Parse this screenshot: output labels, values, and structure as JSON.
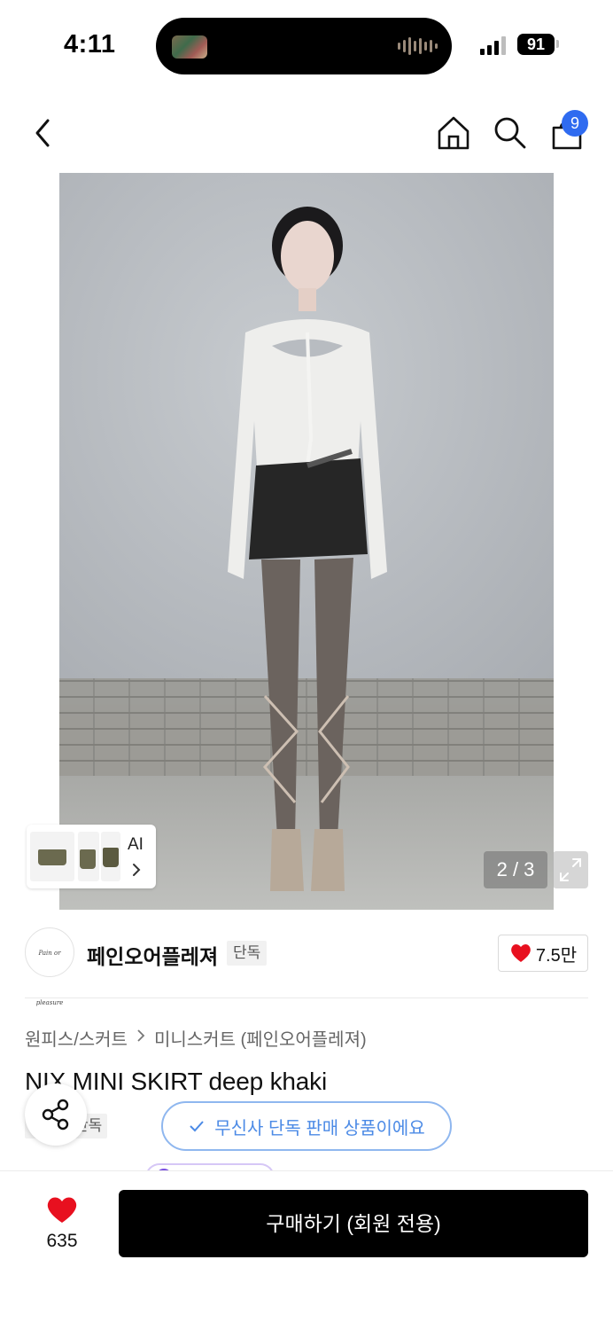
{
  "status_bar": {
    "time": "4:11",
    "battery": "91"
  },
  "nav": {
    "cart_count": "9"
  },
  "gallery": {
    "counter": "2 / 3",
    "ai_label": "AI"
  },
  "brand": {
    "name": "페인오어플레져",
    "tag": "단독",
    "logo_text": "Pain or pleasure",
    "likes": "7.5만"
  },
  "breadcrumb": [
    "원피스/스커트",
    "미니스커트 (페인오어플레져)"
  ],
  "product": {
    "title": "NIX MINI SKIRT deep khaki",
    "tag": "단독",
    "exclusive_notice": "무신사 단독 판매 상품이에요"
  },
  "bottom": {
    "wish_count": "635",
    "buy_label": "구매하기 (회원 전용)"
  },
  "colors": {
    "accent_blue": "#2f6bf0",
    "heart_red": "#e8101f",
    "notice_blue": "#4b8ae6"
  }
}
